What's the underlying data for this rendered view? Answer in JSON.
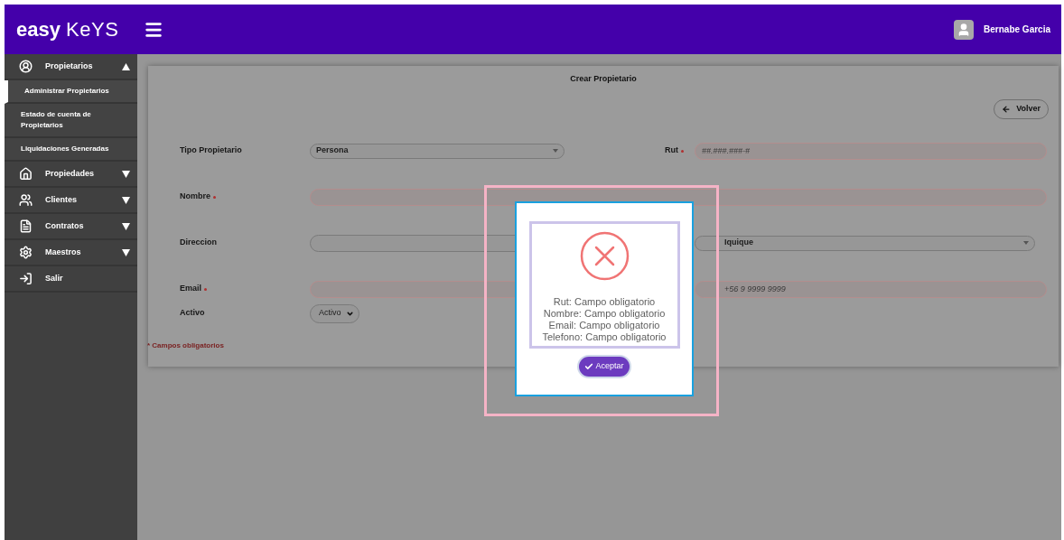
{
  "header": {
    "logo": {
      "bold": "easy",
      "light": "KeYS"
    },
    "user": "Bernabe Garcia"
  },
  "sidebar": {
    "items": [
      {
        "label": "Propietarios",
        "kind": "group",
        "expanded": true,
        "children": [
          {
            "label": "Administrar Propietarios",
            "selected": true
          },
          {
            "label": "Estado de cuenta de Propietarios",
            "selected": false
          },
          {
            "label": "Liquidaciones Generadas",
            "selected": false
          }
        ]
      },
      {
        "label": "Propiedades",
        "kind": "group",
        "expanded": false
      },
      {
        "label": "Clientes",
        "kind": "group",
        "expanded": false
      },
      {
        "label": "Contratos",
        "kind": "group",
        "expanded": false
      },
      {
        "label": "Maestros",
        "kind": "group",
        "expanded": false
      },
      {
        "label": "Salir",
        "kind": "link"
      }
    ]
  },
  "form": {
    "title": "Crear Propietario",
    "back_button": "Volver",
    "rows": [
      {
        "cells": [
          {
            "label": "Tipo Propietario",
            "required": false,
            "kind": "select",
            "value": "Persona",
            "invalid": false
          },
          {
            "label": "Rut",
            "required": true,
            "kind": "input",
            "placeholder": "##.###.###-#",
            "invalid": true
          }
        ]
      },
      {
        "cells": [
          {
            "label": "Nombre",
            "required": true,
            "kind": "input",
            "invalid": true
          }
        ]
      },
      {
        "cells": [
          {
            "label": "Direccion",
            "required": false,
            "kind": "input",
            "invalid": false
          },
          {
            "kind": "select",
            "value": "Iquique",
            "invalid": false
          }
        ]
      },
      {
        "cells": [
          {
            "label": "Email",
            "required": true,
            "kind": "input",
            "invalid": true
          },
          {
            "kind": "input",
            "placeholder": "+56 9 9999 9999",
            "invalid": true
          }
        ]
      },
      {
        "cells": [
          {
            "label": "Activo",
            "required": false,
            "kind": "native-select",
            "value": "Activo",
            "invalid": false
          }
        ]
      }
    ],
    "note": "* Campos obligatorios"
  },
  "dialog": {
    "messages": [
      "Rut: Campo obligatorio",
      "Nombre: Campo obligatorio",
      "Email: Campo obligatorio",
      "Telefono: Campo obligatorio"
    ],
    "button": "Aceptar"
  }
}
